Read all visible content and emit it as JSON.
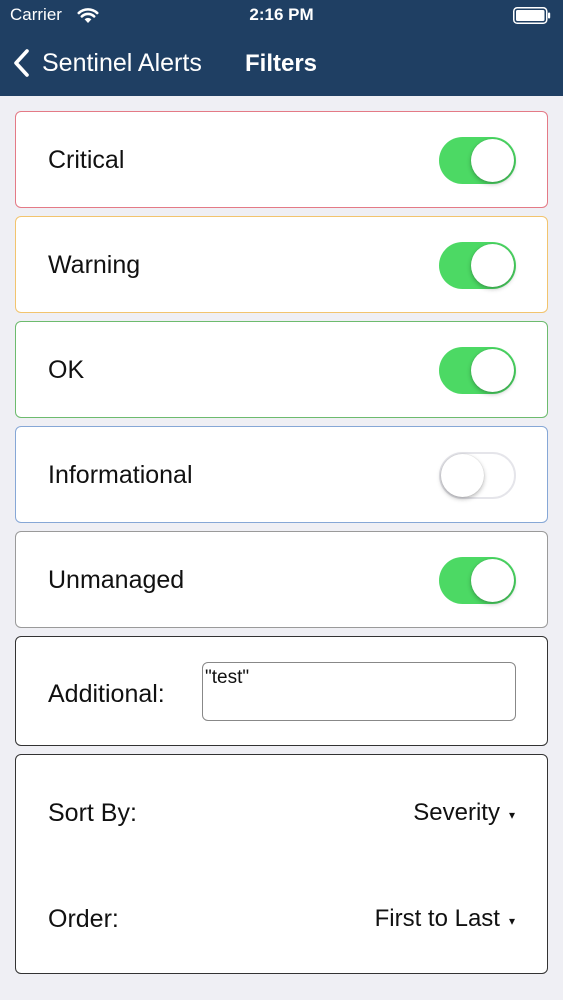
{
  "status_bar": {
    "carrier": "Carrier",
    "time": "2:16 PM",
    "wifi_icon": "wifi-icon",
    "battery_icon": "battery-icon"
  },
  "nav": {
    "back_label": "Sentinel Alerts",
    "title": "Filters",
    "back_icon": "chevron-left-icon"
  },
  "filters": {
    "critical": {
      "label": "Critical",
      "enabled": true,
      "color": "#e47a86"
    },
    "warning": {
      "label": "Warning",
      "enabled": true,
      "color": "#f2c46e"
    },
    "ok": {
      "label": "OK",
      "enabled": true,
      "color": "#6dbb6e"
    },
    "informational": {
      "label": "Informational",
      "enabled": false,
      "color": "#86a7d6"
    },
    "unmanaged": {
      "label": "Unmanaged",
      "enabled": true,
      "color": "#9a9a9a"
    }
  },
  "additional": {
    "label": "Additional:",
    "value": "\"test\""
  },
  "sort": {
    "sort_by_label": "Sort By:",
    "sort_by_value": "Severity",
    "order_label": "Order:",
    "order_value": "First to Last",
    "caret": "▾"
  },
  "colors": {
    "nav_background": "#1f3f63",
    "toggle_on": "#4cd964",
    "page_background": "#efeff4"
  }
}
